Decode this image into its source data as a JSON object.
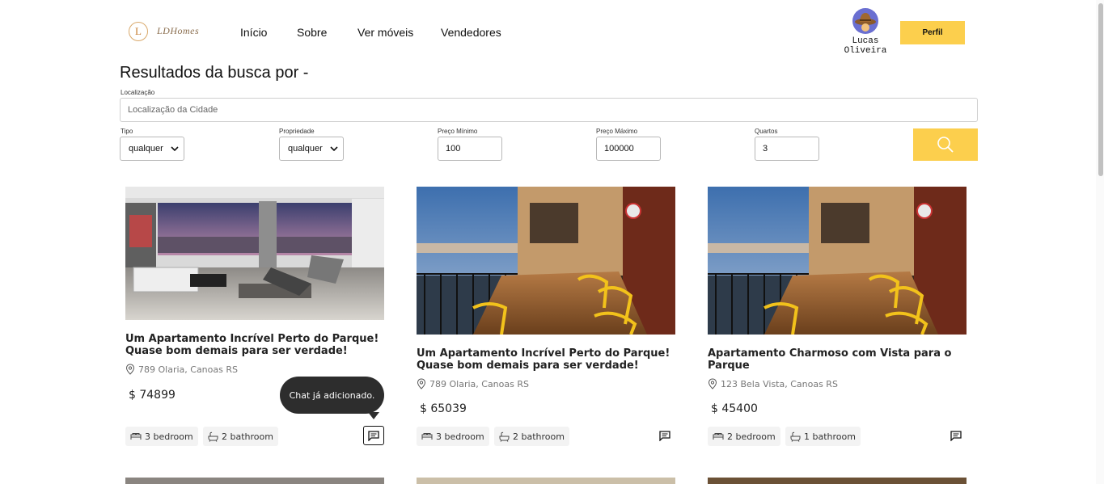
{
  "header": {
    "logo_letter": "L",
    "logo_text": "LDHomes",
    "nav": [
      "Início",
      "Sobre",
      "Ver móveis",
      "Vendedores"
    ],
    "user_name_line1": "Lucas",
    "user_name_line2": "Oliveira",
    "profile_button": "Perfil"
  },
  "search": {
    "title": "Resultados da busca por -",
    "location_label": "Localização",
    "location_placeholder": "Localização da Cidade",
    "tipo_label": "Tipo",
    "tipo_value": "qualquer",
    "propriedade_label": "Propriedade",
    "propriedade_value": "qualquer",
    "preco_min_label": "Preço Mínimo",
    "preco_min_value": "100",
    "preco_max_label": "Preço Máximo",
    "preco_max_value": "100000",
    "quartos_label": "Quartos",
    "quartos_value": "3"
  },
  "listings": [
    {
      "title": "Um Apartamento Incrível Perto do Parque! Quase bom demais para ser verdade!",
      "address": "789 Olaria, Canoas RS",
      "price": "$ 74899",
      "bedrooms": "3 bedroom",
      "bathrooms": "2 bathroom",
      "tooltip": "Chat já adicionado."
    },
    {
      "title": "Um Apartamento Incrível Perto do Parque! Quase bom demais para ser verdade!",
      "address": "789 Olaria, Canoas RS",
      "price": "$ 65039",
      "bedrooms": "3 bedroom",
      "bathrooms": "2 bathroom"
    },
    {
      "title": "Apartamento Charmoso com Vista para o Parque",
      "address": "123 Bela Vista, Canoas RS",
      "price": "$ 45400",
      "bedrooms": "2 bedroom",
      "bathrooms": "1 bathroom"
    }
  ],
  "colors": {
    "accent": "#fccf4d",
    "tooltip_bg": "#2d2d2d"
  },
  "icons": [
    "logo-icon",
    "avatar",
    "chevron-down-icon",
    "search-icon",
    "location-pin-icon",
    "bed-icon",
    "bath-icon",
    "chat-icon"
  ]
}
